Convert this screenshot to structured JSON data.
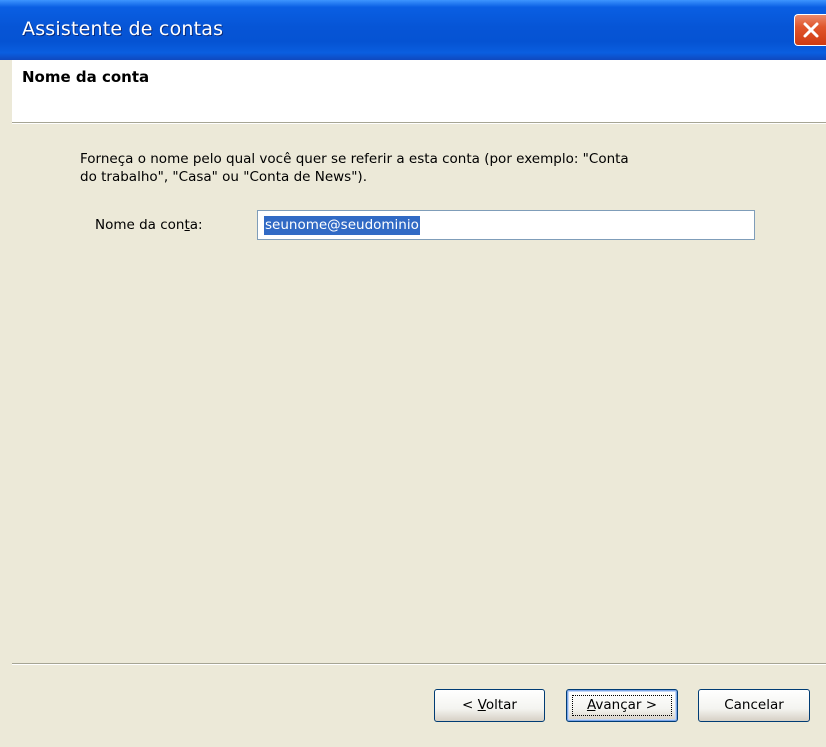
{
  "window": {
    "title": "Assistente de contas"
  },
  "header": {
    "title": "Nome da conta"
  },
  "body": {
    "description_line1": "Forneça o nome pelo qual você quer se referir a esta conta (por exemplo: \"Conta",
    "description_line2": "do trabalho\", \"Casa\" ou \"Conta de News\").",
    "field_label_before": "Nome da con",
    "field_label_accel": "t",
    "field_label_after": "a:",
    "account_name_value": "seunome@seudominio"
  },
  "buttons": {
    "back_prefix": "< ",
    "back_accel": "V",
    "back_rest": "oltar",
    "next_accel": "A",
    "next_rest": "vançar >",
    "cancel_label": "Cancelar"
  },
  "colors": {
    "titlebar": "#0553d3",
    "dialog_bg": "#ece9d8",
    "selection": "#316ac5",
    "close_button": "#e0562c"
  },
  "icons": {
    "close": "close-icon"
  }
}
